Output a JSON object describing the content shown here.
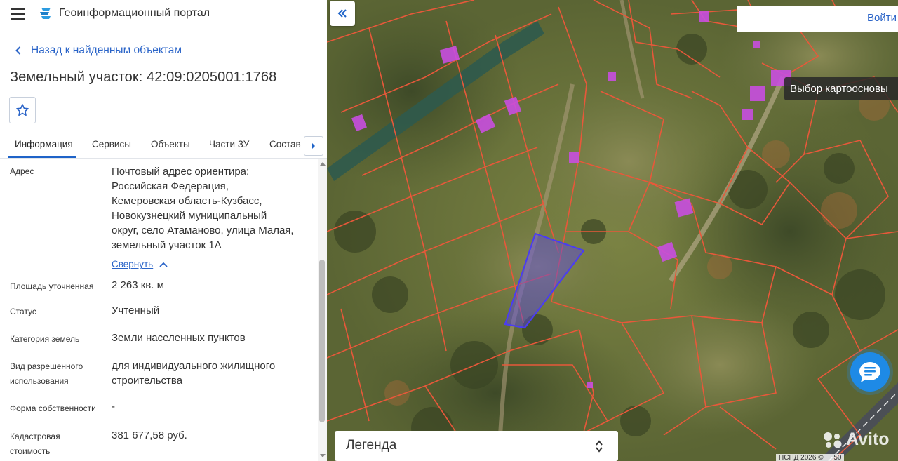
{
  "header": {
    "app_title": "Геоинформационный портал"
  },
  "nav": {
    "back_label": "Назад к найденным объектам"
  },
  "object": {
    "title": "Земельный участок: 42:09:0205001:1768"
  },
  "tabs": [
    {
      "label": "Информация",
      "active": true
    },
    {
      "label": "Сервисы"
    },
    {
      "label": "Объекты"
    },
    {
      "label": "Части ЗУ"
    },
    {
      "label": "Состав"
    }
  ],
  "fields": {
    "address": {
      "label": "Адрес",
      "lines": [
        "Почтовый адрес ориентира:",
        "Российская Федерация,",
        "Кемеровская область-Кузбасс,",
        "Новокузнецкий муниципальный",
        "округ, село Атаманово, улица Малая,",
        "земельный участок 1А"
      ],
      "collapse_label": "Свернуть"
    },
    "area": {
      "label": "Площадь уточненная",
      "value": "2 263 кв. м"
    },
    "status": {
      "label": "Статус",
      "value": "Учтенный"
    },
    "category": {
      "label": "Категория земель",
      "value": "Земли населенных пунктов"
    },
    "permitted_use": {
      "label_lines": [
        "Вид разрешенного",
        "использования"
      ],
      "value_lines": [
        "для индивидуального жилищного",
        "строительства"
      ]
    },
    "ownership": {
      "label": "Форма собственности",
      "value": "-"
    },
    "cadastral_value": {
      "label_lines": [
        "Кадастровая",
        "стоимость"
      ],
      "value": "381 677,58 руб."
    }
  },
  "map": {
    "login_label": "Войти",
    "basemap_label": "Выбор картоосновы",
    "legend_label": "Легенда",
    "watermark": "Avito",
    "copyright": "НСПД 2026 ©",
    "scale_text": "50",
    "colors": {
      "parcel_border": "#e8583a",
      "selected_parcel": "#4b3df0",
      "building": "#c94fe0",
      "accent": "#1e63c8"
    }
  },
  "icons": {
    "menu": "menu-icon",
    "logo": "portal-logo-icon",
    "back": "chevron-left-icon",
    "favorite": "star-icon",
    "tabs_scroll": "chevron-right-icon",
    "collapse_panel": "double-chevron-left-icon",
    "chat": "chat-icon",
    "legend_toggle": "sort-arrows-icon"
  }
}
